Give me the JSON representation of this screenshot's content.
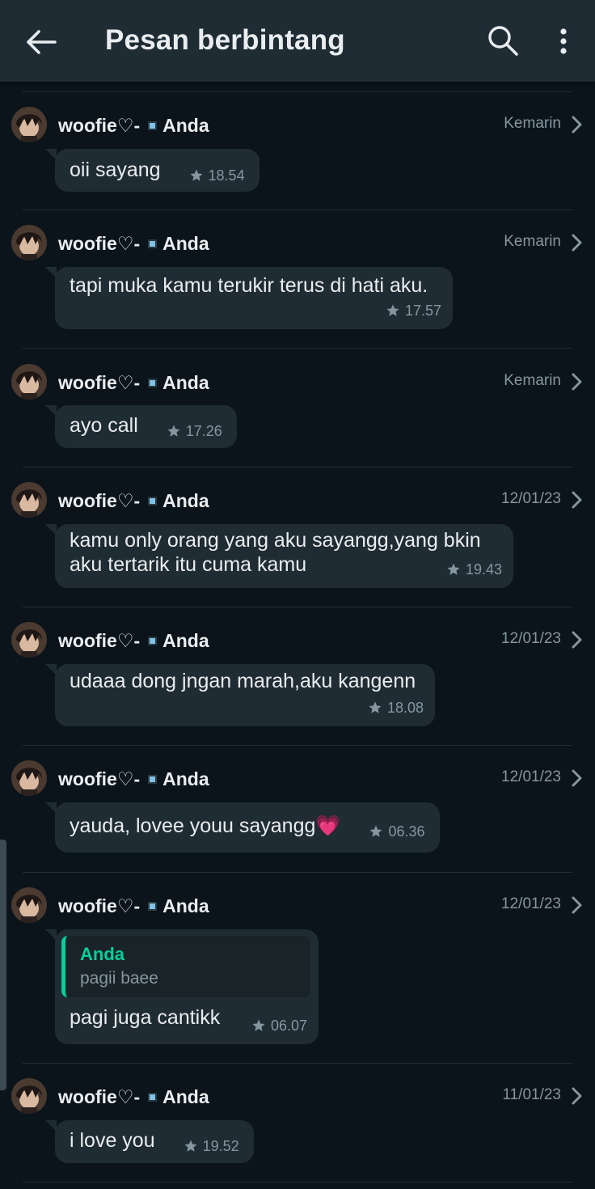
{
  "header": {
    "title": "Pesan berbintang"
  },
  "messages": [
    {
      "sender": "woofie♡-",
      "recipient": "Anda",
      "date": "Kemarin",
      "text": "oii sayang",
      "time": "18.54"
    },
    {
      "sender": "woofie♡-",
      "recipient": "Anda",
      "date": "Kemarin",
      "text": "tapi muka kamu terukir terus di hati aku.",
      "time": "17.57"
    },
    {
      "sender": "woofie♡-",
      "recipient": "Anda",
      "date": "Kemarin",
      "text": "ayo call",
      "time": "17.26"
    },
    {
      "sender": "woofie♡-",
      "recipient": "Anda",
      "date": "12/01/23",
      "text": "kamu only orang yang aku sayangg,yang bkin aku tertarik itu cuma kamu",
      "time": "19.43"
    },
    {
      "sender": "woofie♡-",
      "recipient": "Anda",
      "date": "12/01/23",
      "text": "udaaa dong jngan marah,aku kangenn",
      "time": "18.08"
    },
    {
      "sender": "woofie♡-",
      "recipient": "Anda",
      "date": "12/01/23",
      "text": "yauda, lovee youu sayangg💗",
      "time": "06.36"
    },
    {
      "sender": "woofie♡-",
      "recipient": "Anda",
      "date": "12/01/23",
      "quote_name": "Anda",
      "quote_text": "pagii baee",
      "text": "pagi juga cantikk",
      "time": "06.07"
    },
    {
      "sender": "woofie♡-",
      "recipient": "Anda",
      "date": "11/01/23",
      "text": "i love you",
      "time": "19.52"
    }
  ],
  "colors": {
    "background": "#0b141a",
    "header": "#1f2c34",
    "bubble": "#202c33",
    "secondary_text": "#8696a0",
    "quote_accent": "#06cf9c"
  },
  "icons": [
    "back-arrow-icon",
    "search-icon",
    "more-options-icon",
    "star-icon",
    "chevron-right-icon",
    "forward-arrow-icon"
  ]
}
